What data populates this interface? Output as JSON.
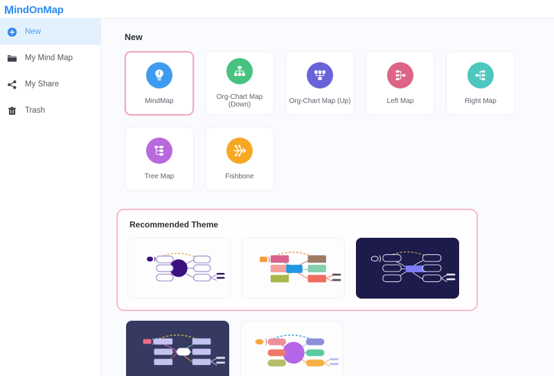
{
  "app": {
    "logo_mark": "M",
    "logo_text": "indOnMap",
    "logo_color": "#2e8bf0"
  },
  "sidebar": {
    "items": [
      {
        "label": "New",
        "icon": "plus-circle-icon",
        "active": true
      },
      {
        "label": "My Mind Map",
        "icon": "folder-icon",
        "active": false
      },
      {
        "label": "My Share",
        "icon": "share-icon",
        "active": false
      },
      {
        "label": "Trash",
        "icon": "trash-icon",
        "active": false
      }
    ]
  },
  "main": {
    "new_section": {
      "title": "New",
      "templates": [
        {
          "label": "MindMap",
          "icon": "lightbulb-icon",
          "color": "#3f9bf0",
          "selected": true
        },
        {
          "label": "Org-Chart Map (Down)",
          "icon": "org-chart-down-icon",
          "color": "#45c37f",
          "selected": false
        },
        {
          "label": "Org-Chart Map (Up)",
          "icon": "org-chart-up-icon",
          "color": "#6a63d8",
          "selected": false
        },
        {
          "label": "Left Map",
          "icon": "left-map-icon",
          "color": "#dd6387",
          "selected": false
        },
        {
          "label": "Right Map",
          "icon": "right-map-icon",
          "color": "#4ec7bf",
          "selected": false
        },
        {
          "label": "Tree Map",
          "icon": "tree-map-icon",
          "color": "#b869dd",
          "selected": false
        },
        {
          "label": "Fishbone",
          "icon": "fishbone-icon",
          "color": "#f7a823",
          "selected": false
        }
      ]
    },
    "theme_section": {
      "title": "Recommended Theme",
      "highlight_color": "#f6b8ce",
      "themes": [
        {
          "name": "theme-purple-light",
          "dark": false
        },
        {
          "name": "theme-colorful",
          "dark": false
        },
        {
          "name": "theme-navy-dark",
          "dark": true
        }
      ],
      "themes_row2": [
        {
          "name": "theme-slate-dark",
          "dark": true
        },
        {
          "name": "theme-pastel-light",
          "dark": false
        }
      ]
    }
  }
}
